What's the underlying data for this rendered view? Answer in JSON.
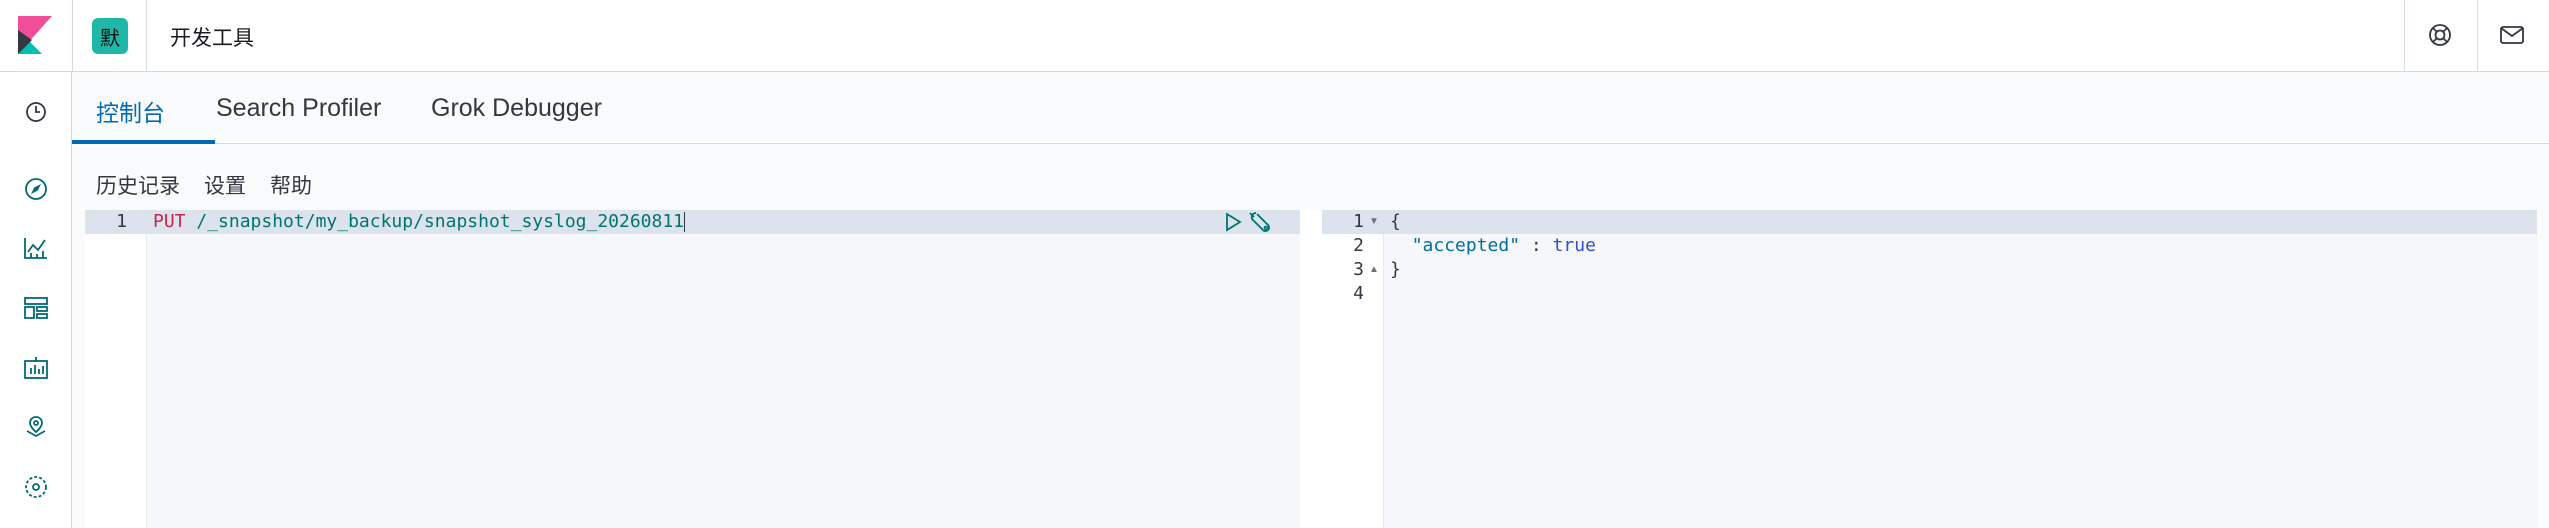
{
  "header": {
    "space_initial": "默",
    "app_title": "开发工具",
    "logo_icon": "kibana-logo-icon",
    "help_icon": "help-lifebuoy-icon",
    "mail_icon": "mail-icon"
  },
  "sidenav": {
    "items": [
      {
        "icon": "clock-icon"
      },
      {
        "icon": "compass-icon"
      },
      {
        "icon": "visualize-icon"
      },
      {
        "icon": "dashboard-icon"
      },
      {
        "icon": "canvas-icon"
      },
      {
        "icon": "maps-icon"
      },
      {
        "icon": "ml-icon"
      }
    ]
  },
  "tabs": [
    {
      "label": "控制台",
      "active": true
    },
    {
      "label": "Search Profiler",
      "active": false
    },
    {
      "label": "Grok Debugger",
      "active": false
    }
  ],
  "menu": {
    "history": "历史记录",
    "settings": "设置",
    "help": "帮助"
  },
  "request_editor": {
    "line_number": "1",
    "method": "PUT",
    "path": "/_snapshot/my_backup/snapshot_syslog_20260811"
  },
  "response_editor": {
    "lines": [
      {
        "n": "1",
        "text": "{"
      },
      {
        "n": "2",
        "key": "\"accepted\"",
        "sep": " : ",
        "value": "true"
      },
      {
        "n": "3",
        "text": "}"
      },
      {
        "n": "4",
        "text": ""
      }
    ]
  },
  "colors": {
    "accent": "#006bb4",
    "space_avatar": "#1fb8a8",
    "method": "#c7254e",
    "path": "#00756f"
  }
}
